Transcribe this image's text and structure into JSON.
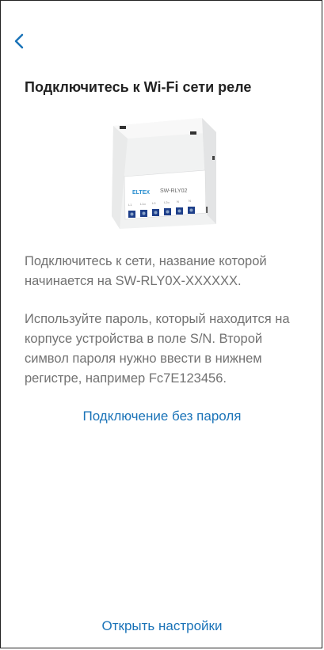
{
  "header": {
    "back_icon": "chevron-left-icon",
    "accent": "#1a73b8"
  },
  "title": "Подключитесь к Wi-Fi сети реле",
  "device": {
    "brand": "ELTEX",
    "model": "SW-RLY02",
    "terminals": [
      "L1",
      "L1o",
      "L0",
      "L2o",
      "N",
      "N"
    ]
  },
  "instructions": {
    "p1": "Подключитесь к сети, название которой начинается на SW-RLY0X-XXXXXX.",
    "p2": "Используйте пароль, который находится на корпусе устройства в поле S/N. Второй символ пароля нужно ввести в нижнем регистре, например Fc7E123456."
  },
  "actions": {
    "no_password": "Подключение без пароля",
    "open_settings": "Открыть настройки"
  }
}
